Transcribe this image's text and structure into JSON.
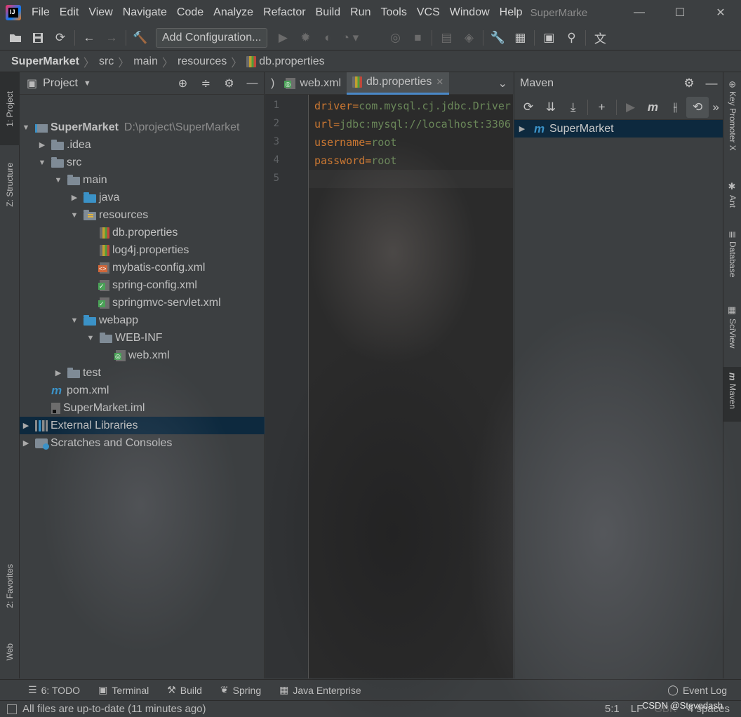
{
  "menu": {
    "items": [
      "File",
      "Edit",
      "View",
      "Navigate",
      "Code",
      "Analyze",
      "Refactor",
      "Build",
      "Run",
      "Tools",
      "VCS",
      "Window",
      "Help"
    ],
    "window_title": "SuperMarke"
  },
  "toolbar": {
    "add_configuration": "Add Configuration..."
  },
  "breadcrumb": [
    "SuperMarket",
    "src",
    "main",
    "resources",
    "db.properties"
  ],
  "left_stripe": {
    "project": "1: Project",
    "structure": "Z: Structure",
    "favorites": "2: Favorites",
    "web": "Web"
  },
  "project_panel": {
    "title": "Project",
    "tree": [
      {
        "label": "SuperMarket",
        "extra": "D:\\project\\SuperMarket",
        "depth": 0,
        "arrow": "down",
        "icon": "module"
      },
      {
        "label": ".idea",
        "depth": 1,
        "arrow": "right",
        "icon": "folder"
      },
      {
        "label": "src",
        "depth": 1,
        "arrow": "down",
        "icon": "folder"
      },
      {
        "label": "main",
        "depth": 2,
        "arrow": "down",
        "icon": "folder"
      },
      {
        "label": "java",
        "depth": 3,
        "arrow": "right",
        "icon": "folder-blue"
      },
      {
        "label": "resources",
        "depth": 3,
        "arrow": "down",
        "icon": "folder-res"
      },
      {
        "label": "db.properties",
        "depth": 4,
        "arrow": "",
        "icon": "prop"
      },
      {
        "label": "log4j.properties",
        "depth": 4,
        "arrow": "",
        "icon": "prop"
      },
      {
        "label": "mybatis-config.xml",
        "depth": 4,
        "arrow": "",
        "icon": "xml"
      },
      {
        "label": "spring-config.xml",
        "depth": 4,
        "arrow": "",
        "icon": "xml-spring"
      },
      {
        "label": "springmvc-servlet.xml",
        "depth": 4,
        "arrow": "",
        "icon": "xml-spring"
      },
      {
        "label": "webapp",
        "depth": 3,
        "arrow": "down",
        "icon": "folder-web"
      },
      {
        "label": "WEB-INF",
        "depth": 4,
        "arrow": "down",
        "icon": "folder"
      },
      {
        "label": "web.xml",
        "depth": 5,
        "arrow": "",
        "icon": "xml-web"
      },
      {
        "label": "test",
        "depth": 2,
        "arrow": "right",
        "icon": "folder"
      },
      {
        "label": "pom.xml",
        "depth": 1,
        "arrow": "",
        "icon": "maven"
      },
      {
        "label": "SuperMarket.iml",
        "depth": 1,
        "arrow": "",
        "icon": "iml"
      },
      {
        "label": "External Libraries",
        "depth": 0,
        "arrow": "right",
        "icon": "libs",
        "selected": true
      },
      {
        "label": "Scratches and Consoles",
        "depth": 0,
        "arrow": "right",
        "icon": "scratch"
      }
    ]
  },
  "editor": {
    "tabs": [
      {
        "label": ")",
        "active": false
      },
      {
        "label": "web.xml",
        "active": false
      },
      {
        "label": "db.properties",
        "active": true
      }
    ],
    "lines": [
      {
        "num": "1",
        "key": "driver",
        "value": "com.mysql.cj.jdbc.Driver"
      },
      {
        "num": "2",
        "key": "url",
        "value": "jdbc:mysql://localhost:3306"
      },
      {
        "num": "3",
        "key": "username",
        "value": "root"
      },
      {
        "num": "4",
        "key": "password",
        "value": "root"
      },
      {
        "num": "5",
        "key": "",
        "value": ""
      }
    ]
  },
  "maven_panel": {
    "title": "Maven",
    "project": "SuperMarket"
  },
  "right_stripe": [
    "Key Promoter X",
    "Ant",
    "Database",
    "SciView",
    "Maven"
  ],
  "bottom_tools": [
    {
      "label": "6: TODO",
      "icon": "list-icon"
    },
    {
      "label": "Terminal",
      "icon": "terminal-icon"
    },
    {
      "label": "Build",
      "icon": "hammer-icon"
    },
    {
      "label": "Spring",
      "icon": "leaf-icon"
    },
    {
      "label": "Java Enterprise",
      "icon": "enterprise-icon"
    }
  ],
  "event_log": "Event Log",
  "status": {
    "message": "All files are up-to-date (11 minutes ago)",
    "position": "5:1",
    "line_sep": "LF",
    "encoding": "GBK",
    "indent": "4 spaces"
  },
  "watermark": "CSDN @Stevedash"
}
